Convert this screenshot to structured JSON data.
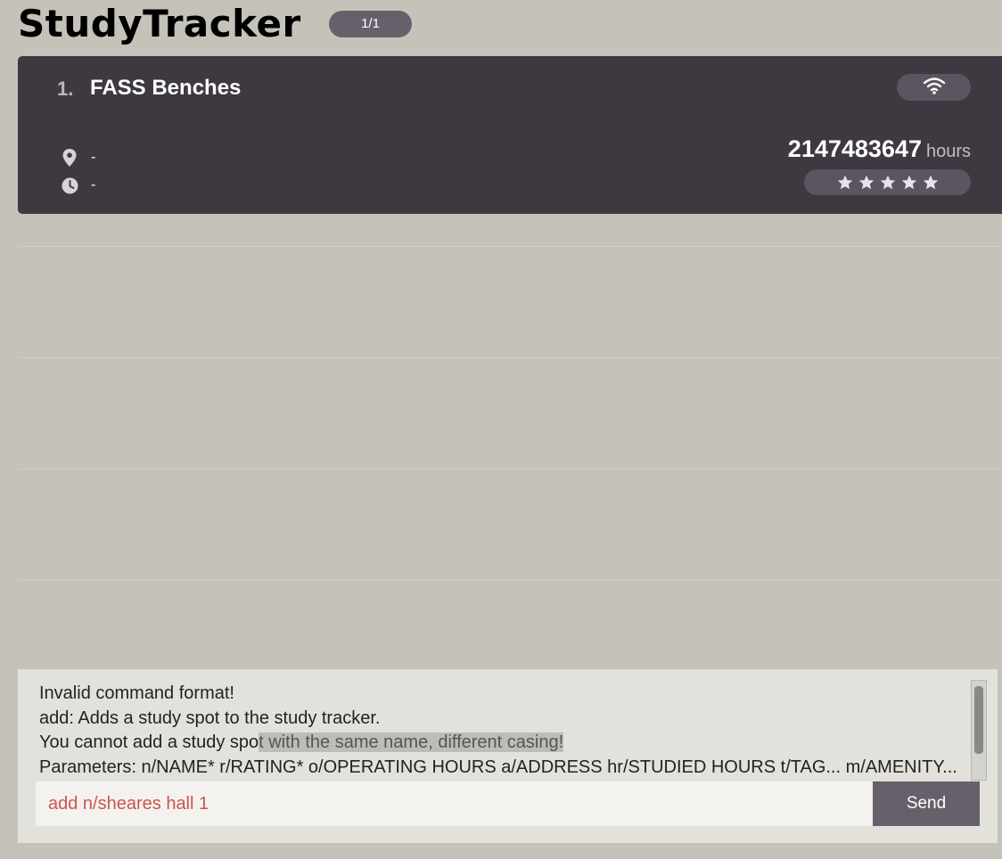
{
  "app": {
    "title": "StudyTracker",
    "page_indicator": "1/1"
  },
  "study_spots": [
    {
      "index": "1.",
      "name": "FASS Benches",
      "amenity_icon": "wifi-icon",
      "address": "-",
      "operating_hours": "-",
      "studied_hours": "2147483647",
      "hours_unit": "hours",
      "rating": 5,
      "rating_max": 5
    }
  ],
  "result_display": {
    "line1": "Invalid command format!",
    "line2": "add: Adds a study spot to the study tracker.",
    "line3_normal": "You cannot add a study spo",
    "line3_highlight": "t with the same name, different casing!",
    "line4": "Parameters: n/NAME* r/RATING* o/OPERATING HOURS a/ADDRESS hr/STUDIED HOURS t/TAG... m/AMENITY..."
  },
  "command_box": {
    "value": "add n/sheares hall 1"
  },
  "send_button": {
    "label": "Send"
  },
  "colors": {
    "background": "#c5c2ba",
    "card": "#3e3940",
    "pill": "#66606b",
    "command_text": "#c8564e"
  }
}
